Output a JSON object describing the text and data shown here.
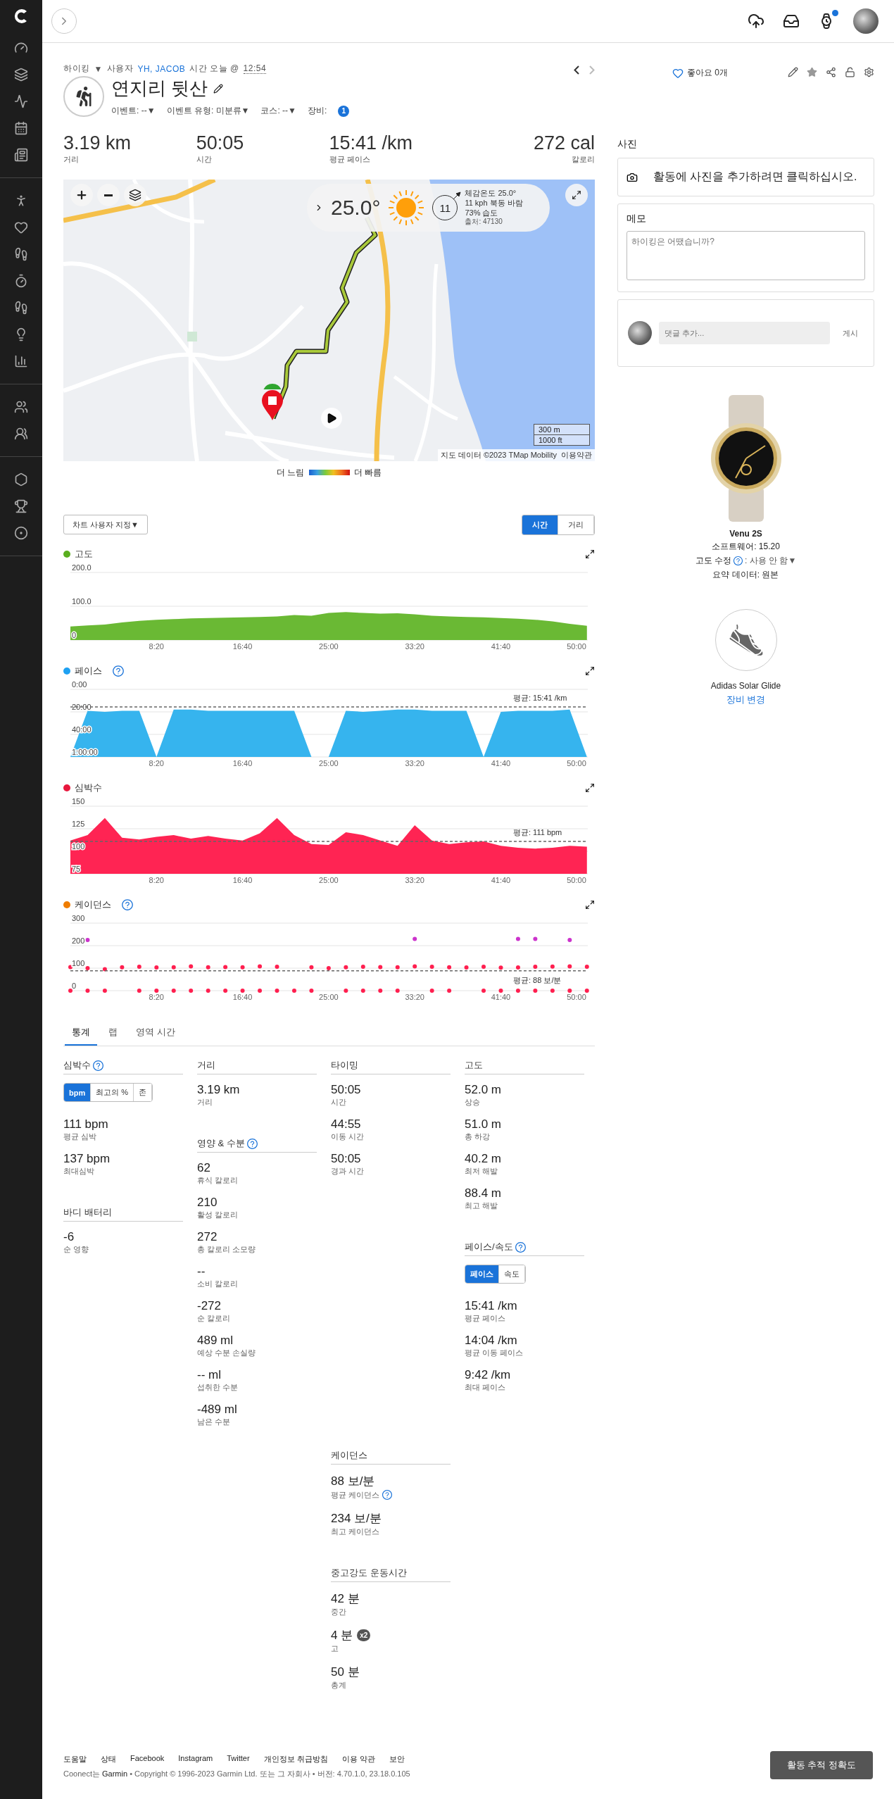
{
  "top_bar": {
    "watch_notification": true
  },
  "activity": {
    "type": "하이킹",
    "type_caret": "▼",
    "by": "사용자",
    "user": "YH, JACOB",
    "time_prefix": "시간 오늘 @",
    "time": "12:54",
    "title": "연지리 뒷산",
    "meta": [
      "이벤트: --▼",
      "이벤트 유형: 미분류▼",
      "코스: --▼"
    ],
    "equipment_label": "장비:",
    "equipment_count": "1",
    "likes": "좋아요 0개",
    "prev_disabled": false,
    "next_disabled": true
  },
  "summary": [
    {
      "value": "3.19 km",
      "label": "거리"
    },
    {
      "value": "50:05",
      "label": "시간"
    },
    {
      "value": "15:41 /km",
      "label": "평균 페이스"
    },
    {
      "value": "272 cal",
      "label": "칼로리"
    }
  ],
  "map": {
    "weather": {
      "temperature": "25.0°",
      "wind_speed": "11",
      "feels_like": "체감온도 25.0°",
      "wind": "11 kph 북동 바람",
      "humidity": "73% 습도",
      "source": "출처: 47130"
    },
    "scale": [
      "300 m",
      "1000 ft"
    ],
    "attribution": "지도 데이터 ©2023 TMap Mobility",
    "terms": "이용약관",
    "legend": {
      "slow": "더 느림",
      "fast": "더 빠름"
    }
  },
  "chart_controls": {
    "customize": "차트 사용자 지정▼",
    "axis_toggle": [
      {
        "label": "시간",
        "selected": true
      },
      {
        "label": "거리",
        "selected": false
      }
    ]
  },
  "charts": [
    {
      "title": "고도",
      "color": "#5aae1f",
      "help": false,
      "chart_data": {
        "type": "area",
        "x": [
          0,
          100,
          200,
          300,
          400,
          500,
          600,
          700,
          800,
          900,
          1000,
          1100,
          1200,
          1300,
          1400,
          1500,
          1600,
          1700,
          1800,
          1900,
          2000,
          2100,
          2200,
          2300,
          2400,
          2500,
          2600,
          2700,
          2800,
          2900,
          3000
        ],
        "xlim": [
          0,
          3005
        ],
        "ylim": [
          0,
          200
        ],
        "xticks": [
          {
            "value": 500,
            "label": "8:20"
          },
          {
            "value": 1000,
            "label": "16:40"
          },
          {
            "value": 1500,
            "label": "25:00"
          },
          {
            "value": 2000,
            "label": "33:20"
          },
          {
            "value": 2500,
            "label": "41:40"
          },
          {
            "value": 3000,
            "label": "50:00"
          }
        ],
        "yticks": [
          {
            "value": 200,
            "label": "200.0"
          },
          {
            "value": 100,
            "label": "100.0"
          },
          {
            "value": 0,
            "label": "0"
          }
        ],
        "series": [
          {
            "color": "#6ab934",
            "values": [
              40,
              43,
              46,
              52,
              57,
              60,
              62,
              64,
              65,
              66,
              67,
              68,
              70,
              74,
              72,
              80,
              83,
              80,
              78,
              79,
              76,
              72,
              70,
              68,
              67,
              65,
              63,
              60,
              55,
              48,
              42
            ]
          }
        ]
      }
    },
    {
      "title": "페이스",
      "color": "#1ea1f2",
      "help": true,
      "chart_data": {
        "type": "area",
        "x": [
          0,
          100,
          200,
          300,
          400,
          500,
          600,
          700,
          800,
          900,
          1000,
          1100,
          1200,
          1300,
          1400,
          1500,
          1600,
          1700,
          1800,
          1900,
          2000,
          2100,
          2200,
          2300,
          2400,
          2500,
          2600,
          2700,
          2800,
          2900,
          3000
        ],
        "xlim": [
          0,
          3005
        ],
        "ylim": [
          3600,
          0
        ],
        "xticks": [
          {
            "value": 500,
            "label": "8:20"
          },
          {
            "value": 1000,
            "label": "16:40"
          },
          {
            "value": 1500,
            "label": "25:00"
          },
          {
            "value": 2000,
            "label": "33:20"
          },
          {
            "value": 2500,
            "label": "41:40"
          },
          {
            "value": 3000,
            "label": "50:00"
          }
        ],
        "yticks": [
          {
            "value": 0,
            "label": "0:00"
          },
          {
            "value": 1200,
            "label": "20:00"
          },
          {
            "value": 2400,
            "label": "40:00"
          },
          {
            "value": 3600,
            "label": "1:00:00"
          }
        ],
        "series": [
          {
            "color": "#36b4ee",
            "values": [
              3600,
              1140,
              1200,
              1140,
              1140,
              3600,
              1080,
              1080,
              1140,
              1140,
              1140,
              1140,
              1140,
              1140,
              3600,
              3600,
              1140,
              1200,
              1140,
              1080,
              1080,
              1140,
              1140,
              1140,
              3600,
              1200,
              1140,
              1140,
              1140,
              1080,
              3600
            ]
          }
        ],
        "ref_lines": [
          {
            "axis": "y",
            "value": 941
          }
        ]
      },
      "average_label": "평균: 15:41 /km"
    },
    {
      "title": "심박수",
      "color": "#e8173d",
      "help": false,
      "chart_data": {
        "type": "area",
        "x": [
          0,
          100,
          200,
          300,
          400,
          500,
          600,
          700,
          800,
          900,
          1000,
          1100,
          1200,
          1300,
          1400,
          1500,
          1600,
          1700,
          1800,
          1900,
          2000,
          2100,
          2200,
          2300,
          2400,
          2500,
          2600,
          2700,
          2800,
          2900,
          3000
        ],
        "xlim": [
          0,
          3005
        ],
        "ylim": [
          75,
          150
        ],
        "xticks": [
          {
            "value": 500,
            "label": "8:20"
          },
          {
            "value": 1000,
            "label": "16:40"
          },
          {
            "value": 1500,
            "label": "25:00"
          },
          {
            "value": 2000,
            "label": "33:20"
          },
          {
            "value": 2500,
            "label": "41:40"
          },
          {
            "value": 3000,
            "label": "50:00"
          }
        ],
        "yticks": [
          {
            "value": 150,
            "label": "150"
          },
          {
            "value": 125,
            "label": "125"
          },
          {
            "value": 100,
            "label": "100"
          },
          {
            "value": 75,
            "label": "75"
          }
        ],
        "series": [
          {
            "color": "#ff2453",
            "values": [
              112,
              118,
              137,
              115,
              113,
              116,
              118,
              114,
              117,
              114,
              112,
              120,
              137,
              118,
              108,
              107,
              121,
              118,
              112,
              106,
              129,
              112,
              108,
              110,
              111,
              106,
              104,
              103,
              104,
              106,
              105
            ]
          }
        ],
        "ref_lines": [
          {
            "axis": "y",
            "value": 111
          }
        ]
      },
      "average_label": "평균: 111 bpm"
    },
    {
      "title": "케이던스",
      "color": "#ef7d00",
      "help": true,
      "chart_data": {
        "type": "scatter",
        "x": [
          0,
          100,
          200,
          300,
          400,
          500,
          600,
          700,
          800,
          900,
          1000,
          1100,
          1200,
          1300,
          1400,
          1500,
          1600,
          1700,
          1800,
          1900,
          2000,
          2100,
          2200,
          2300,
          2400,
          2500,
          2600,
          2700,
          2800,
          2900,
          3000
        ],
        "xlim": [
          0,
          3005
        ],
        "ylim": [
          0,
          300
        ],
        "xticks": [
          {
            "value": 500,
            "label": "8:20"
          },
          {
            "value": 1000,
            "label": "16:40"
          },
          {
            "value": 1500,
            "label": "25:00"
          },
          {
            "value": 2000,
            "label": "33:20"
          },
          {
            "value": 2500,
            "label": "41:40"
          },
          {
            "value": 3000,
            "label": "50:00"
          }
        ],
        "yticks": [
          {
            "value": 300,
            "label": "300"
          },
          {
            "value": 200,
            "label": "200"
          },
          {
            "value": 100,
            "label": "100"
          },
          {
            "value": 0,
            "label": "0"
          }
        ],
        "series": [
          {
            "color": "#ff1f4f",
            "values": [
              105,
              100,
              95,
              104,
              106,
              103,
              104,
              108,
              104,
              105,
              104,
              108,
              106,
              null,
              104,
              100,
              104,
              106,
              105,
              104,
              108,
              106,
              104,
              103,
              106,
              102,
              103,
              106,
              107,
              108,
              106
            ]
          },
          {
            "color": "#ff1f4f",
            "values": [
              0,
              0,
              0,
              null,
              0,
              0,
              0,
              0,
              0,
              0,
              0,
              0,
              0,
              0,
              0,
              null,
              0,
              0,
              0,
              0,
              null,
              0,
              0,
              null,
              0,
              0,
              0,
              0,
              0,
              0,
              0
            ]
          },
          {
            "color": "#cc33cc",
            "values": [
              null,
              225,
              null,
              null,
              null,
              null,
              null,
              null,
              null,
              null,
              null,
              null,
              null,
              null,
              null,
              null,
              null,
              null,
              null,
              null,
              230,
              null,
              null,
              null,
              null,
              null,
              230,
              230,
              null,
              225,
              null
            ]
          }
        ],
        "ref_lines": [
          {
            "axis": "y",
            "value": 88
          }
        ]
      },
      "average_label": "평균: 88 보/분"
    }
  ],
  "stats_tabs": [
    {
      "label": "통계",
      "selected": true
    },
    {
      "label": "랩",
      "selected": false
    },
    {
      "label": "영역 시간",
      "selected": false
    }
  ],
  "stats_columns": [
    [
      {
        "title": "심박수",
        "help": true,
        "toggle": [
          {
            "label": "bpm",
            "selected": true
          },
          {
            "label": "최고의 %",
            "selected": false
          },
          {
            "label": "존",
            "selected": false
          }
        ],
        "items": [
          {
            "value": "111 bpm",
            "label": "평균 심박"
          },
          {
            "value": "137 bpm",
            "label": "최대심박"
          }
        ]
      },
      {
        "title": "바디 배터리",
        "help": false,
        "items": [
          {
            "value": "-6",
            "label": "순 영향"
          }
        ]
      }
    ],
    [
      {
        "title": "거리",
        "help": false,
        "items": [
          {
            "value": "3.19 km",
            "label": "거리"
          }
        ]
      },
      {
        "title": "영양 & 수분",
        "help": true,
        "items": [
          {
            "value": "62",
            "label": "휴식 칼로리"
          },
          {
            "value": "210",
            "label": "활성 칼로리"
          },
          {
            "value": "272",
            "label": "총 칼로리 소모량"
          },
          {
            "value": "--",
            "label": "소비 칼로리"
          },
          {
            "value": "-272",
            "label": "순 칼로리"
          },
          {
            "value": "489 ml",
            "label": "예상 수분 손실량"
          },
          {
            "value": "-- ml",
            "label": "섭취한 수분"
          },
          {
            "value": "-489 ml",
            "label": "남은 수분"
          }
        ]
      }
    ],
    [
      {
        "title": "타이밍",
        "help": false,
        "items": [
          {
            "value": "50:05",
            "label": "시간"
          },
          {
            "value": "44:55",
            "label": "이동 시간"
          },
          {
            "value": "50:05",
            "label": "경과 시간"
          }
        ]
      },
      {
        "title": "케이던스",
        "help": false,
        "items": [
          {
            "value": "88 보/분",
            "label": "평균 케이던스",
            "label_help": true
          },
          {
            "value": "234 보/분",
            "label": "최고 케이던스"
          }
        ]
      },
      {
        "title": "중고강도 운동시간",
        "help": false,
        "items": [
          {
            "value": "42 분",
            "label": "중간"
          },
          {
            "value": "4 분",
            "badge": "x2",
            "label": "고"
          },
          {
            "value": "50 분",
            "label": "총계"
          }
        ]
      }
    ],
    [
      {
        "title": "고도",
        "help": false,
        "items": [
          {
            "value": "52.0 m",
            "label": "상승"
          },
          {
            "value": "51.0 m",
            "label": "총 하강"
          },
          {
            "value": "40.2 m",
            "label": "최저 해발"
          },
          {
            "value": "88.4 m",
            "label": "최고 해발"
          }
        ]
      },
      {
        "title": "페이스/속도",
        "help": true,
        "toggle": [
          {
            "label": "페이스",
            "selected": true
          },
          {
            "label": "속도",
            "selected": false
          }
        ],
        "items": [
          {
            "value": "15:41 /km",
            "label": "평균 페이스"
          },
          {
            "value": "14:04 /km",
            "label": "평균 이동 페이스"
          },
          {
            "value": "9:42 /km",
            "label": "최대 페이스"
          }
        ]
      }
    ]
  ],
  "right": {
    "photos_title": "사진",
    "photo_prompt": "활동에 사진을 추가하려면 클릭하십시오.",
    "memo_title": "메모",
    "memo_placeholder": "하이킹은 어땠습니까?",
    "comment_placeholder": "댓글 추가...",
    "post": "게시",
    "device": {
      "name": "Venu 2S",
      "software": "소프트웨어: 15.20",
      "elevation_label": "고도 수정",
      "elevation_value": ": 사용 안 함▼",
      "summary": "요약 데이터: 원본"
    },
    "gear": {
      "name": "Adidas Solar Glide",
      "change": "장비 변경"
    }
  },
  "footer": {
    "links": [
      "도움말",
      "상태",
      "Facebook",
      "Instagram",
      "Twitter",
      "개인정보 취급방침",
      "이용 약관",
      "보안"
    ],
    "copyright": "Coonect는 **Garmin** • Copyright © 1996-2023 Garmin Ltd. 또는 그 자회사 • 버전: 4.70.1.0, 23.18.0.105"
  },
  "accuracy_button": "활동 추적 정확도"
}
